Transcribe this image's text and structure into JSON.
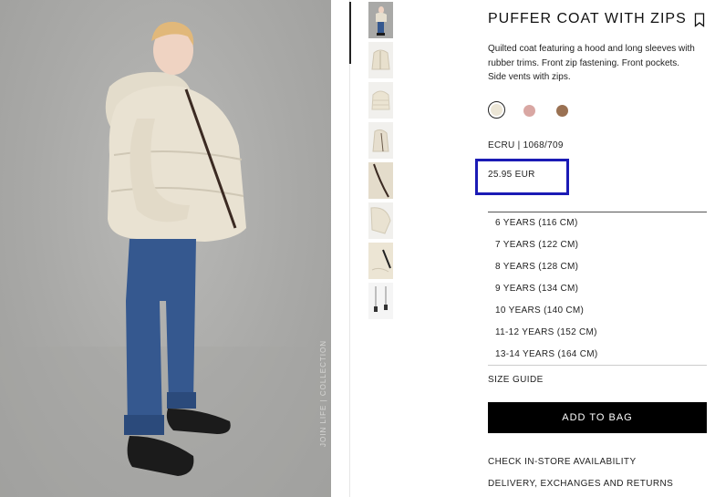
{
  "product": {
    "title": "PUFFER COAT WITH ZIPS",
    "description": "Quilted coat featuring a hood and long sleeves with rubber trims. Front zip fastening. Front pockets. Side vents with zips.",
    "reference": "ECRU | 1068/709",
    "price": "25.95 EUR",
    "photo_caption": "JOIN LIFE | COLLECTION"
  },
  "colors": [
    {
      "name": "ecru",
      "hex": "#ece6d6",
      "selected": true
    },
    {
      "name": "pink",
      "hex": "#d9a7a3",
      "selected": false
    },
    {
      "name": "brown",
      "hex": "#9a7152",
      "selected": false
    }
  ],
  "sizes": [
    "6 YEARS (116 CM)",
    "7 YEARS (122 CM)",
    "8 YEARS (128 CM)",
    "9 YEARS (134 CM)",
    "10 YEARS (140 CM)",
    "11-12 YEARS (152 CM)",
    "13-14 YEARS (164 CM)"
  ],
  "actions": {
    "size_guide": "SIZE GUIDE",
    "add_to_bag": "ADD TO BAG",
    "store_availability": "CHECK IN-STORE AVAILABILITY",
    "delivery": "DELIVERY, EXCHANGES AND RETURNS"
  },
  "thumbnails": [
    {
      "name": "model-full"
    },
    {
      "name": "coat-front"
    },
    {
      "name": "coat-back"
    },
    {
      "name": "coat-side"
    },
    {
      "name": "zip-detail"
    },
    {
      "name": "sleeve-detail"
    },
    {
      "name": "pocket-detail"
    },
    {
      "name": "zip-pulls"
    }
  ],
  "highlight_color": "#1b1bb5"
}
